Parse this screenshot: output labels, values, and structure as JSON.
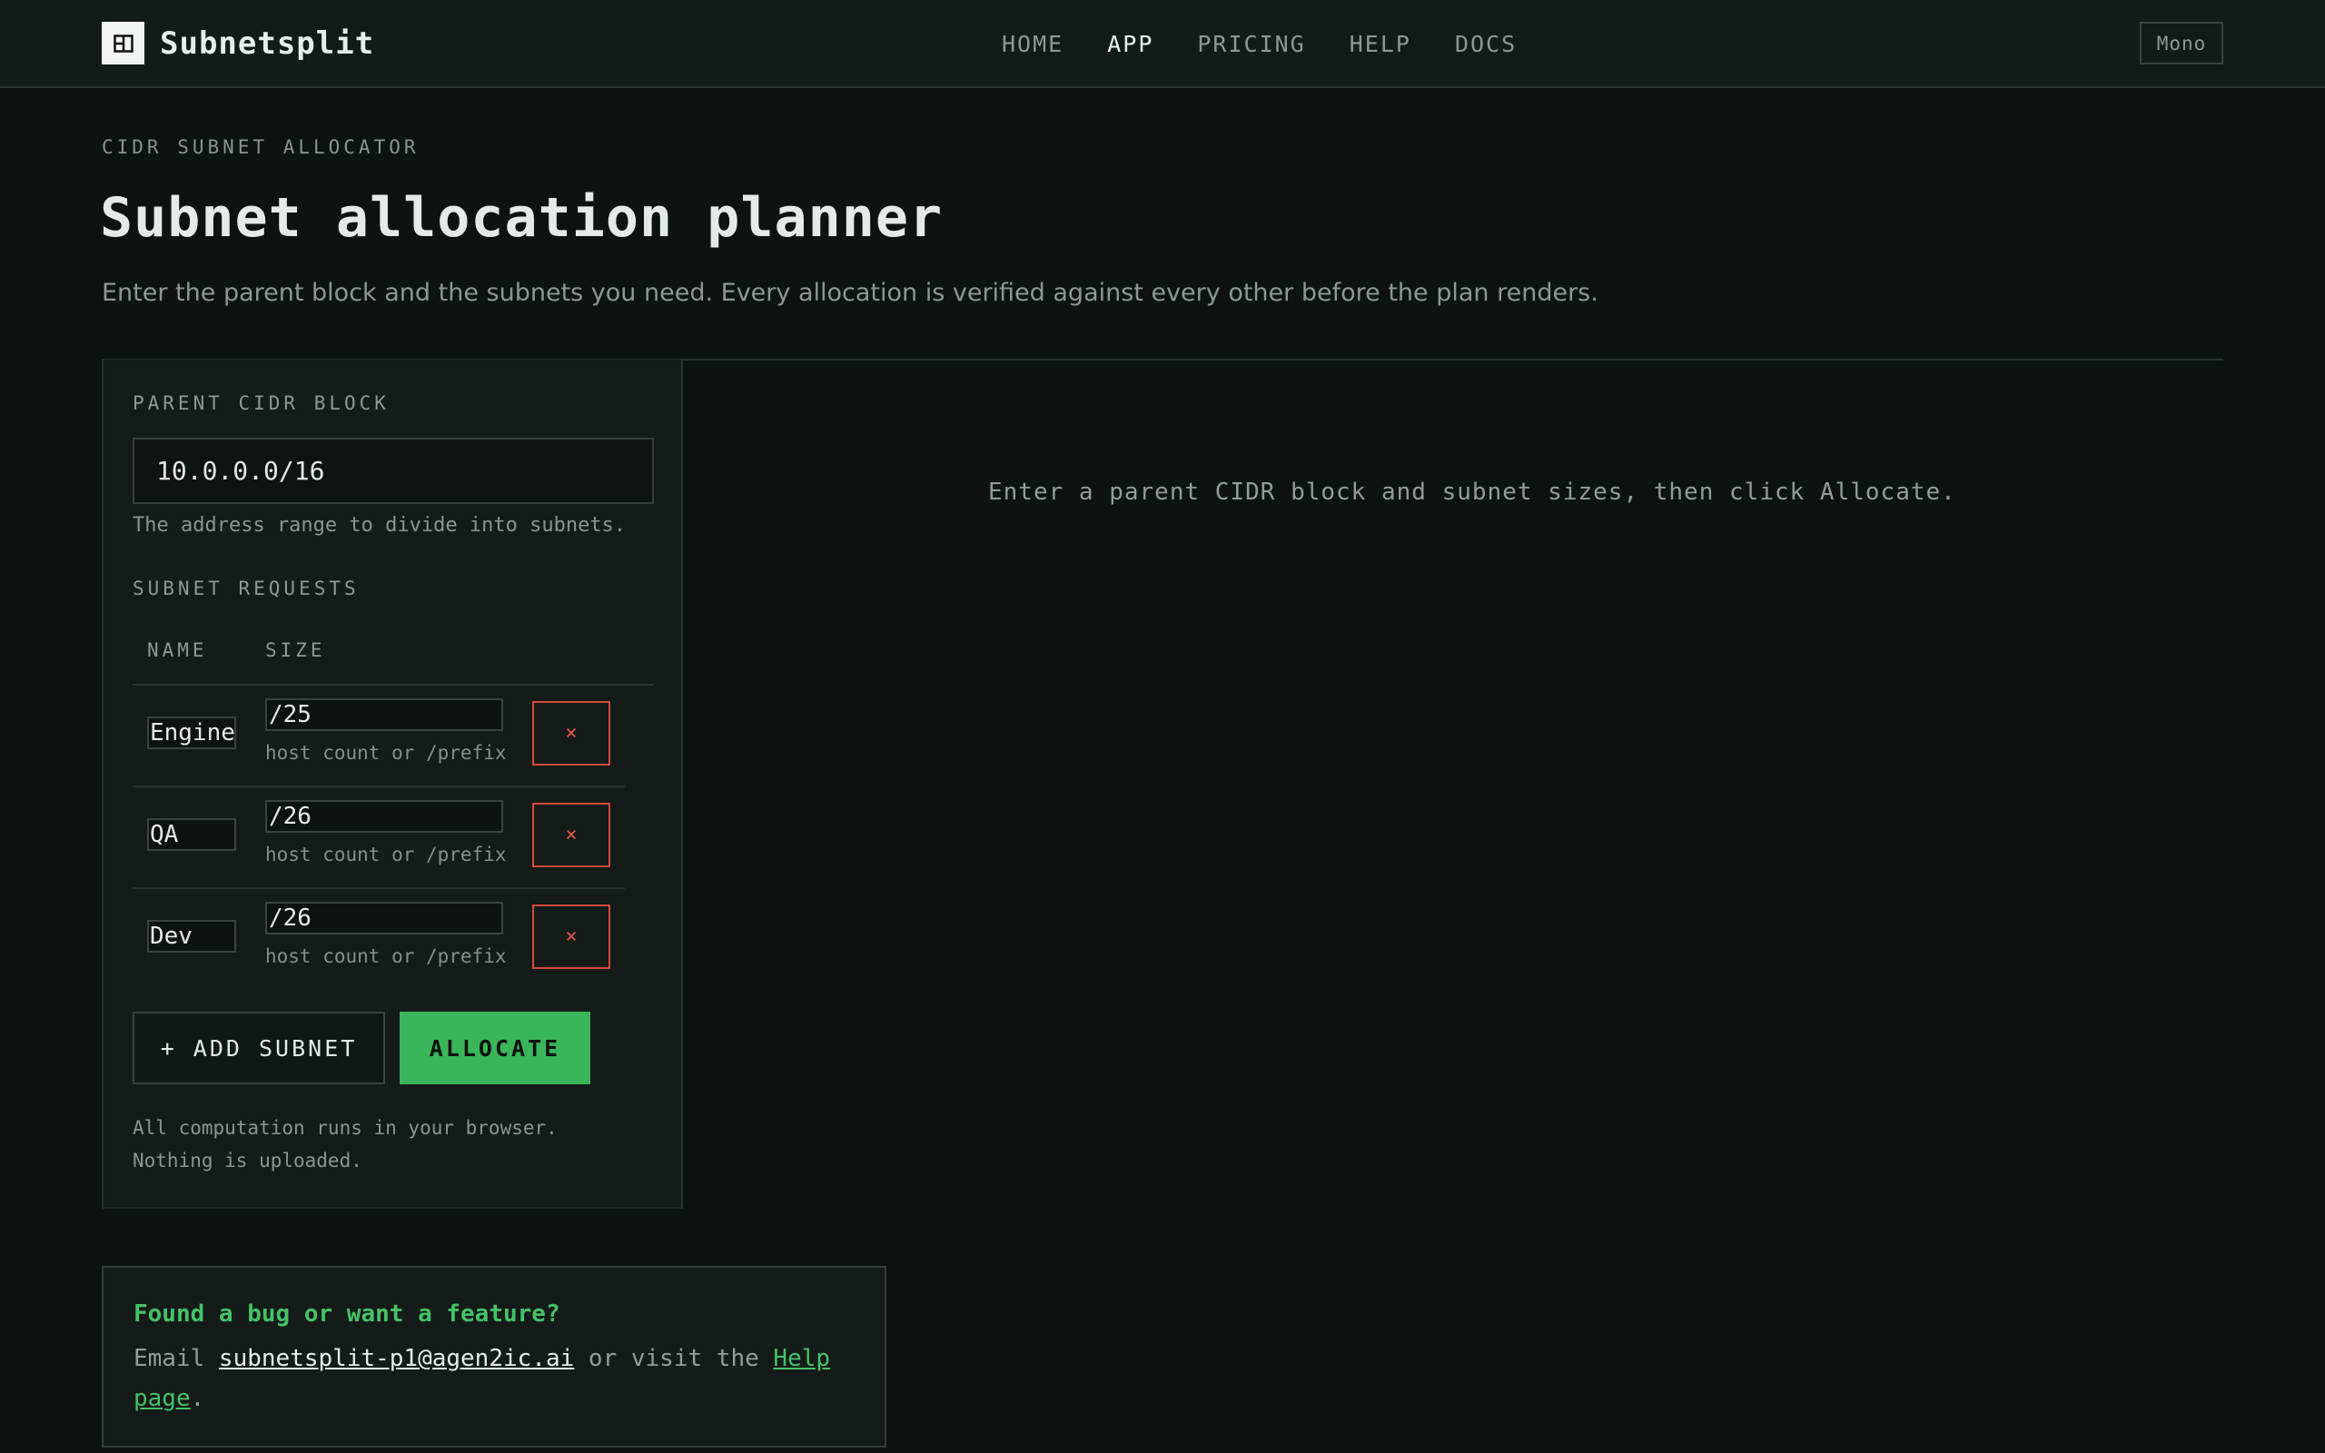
{
  "header": {
    "brand": "Subnetsplit",
    "nav": [
      "HOME",
      "APP",
      "PRICING",
      "HELP",
      "DOCS"
    ],
    "active_nav": "APP",
    "font_toggle": "Mono"
  },
  "intro": {
    "eyebrow": "CIDR SUBNET ALLOCATOR",
    "title": "Subnet allocation planner",
    "subtitle": "Enter the parent block and the subnets you need. Every allocation is verified against every other before the plan renders."
  },
  "form": {
    "parent_label": "PARENT CIDR BLOCK",
    "parent_value": "10.0.0.0/16",
    "parent_hint": "The address range to divide into subnets.",
    "requests_label": "SUBNET REQUESTS",
    "col_name": "NAME",
    "col_size": "SIZE",
    "rows": [
      {
        "name": "Engineering",
        "size": "/25",
        "hint": "host count or /prefix",
        "remove": "×"
      },
      {
        "name": "QA",
        "size": "/26",
        "hint": "host count or /prefix",
        "remove": "×"
      },
      {
        "name": "Dev",
        "size": "/26",
        "hint": "host count or /prefix",
        "remove": "×"
      }
    ],
    "add_button": "+ ADD SUBNET",
    "allocate_button": "ALLOCATE",
    "privacy_note": "All computation runs in your browser. Nothing is uploaded."
  },
  "result": {
    "empty_message": "Enter a parent CIDR block and subnet sizes, then click Allocate."
  },
  "feedback": {
    "title": "Found a bug or want a feature?",
    "prefix": "Email ",
    "email": "subnetsplit-p1@agen2ic.ai",
    "middle": " or visit the ",
    "link": "Help page",
    "suffix": "."
  },
  "colors": {
    "background": "#0e1312",
    "panel": "#151b19",
    "accent_green": "#3bb55a",
    "danger_red": "#d54a3f"
  }
}
